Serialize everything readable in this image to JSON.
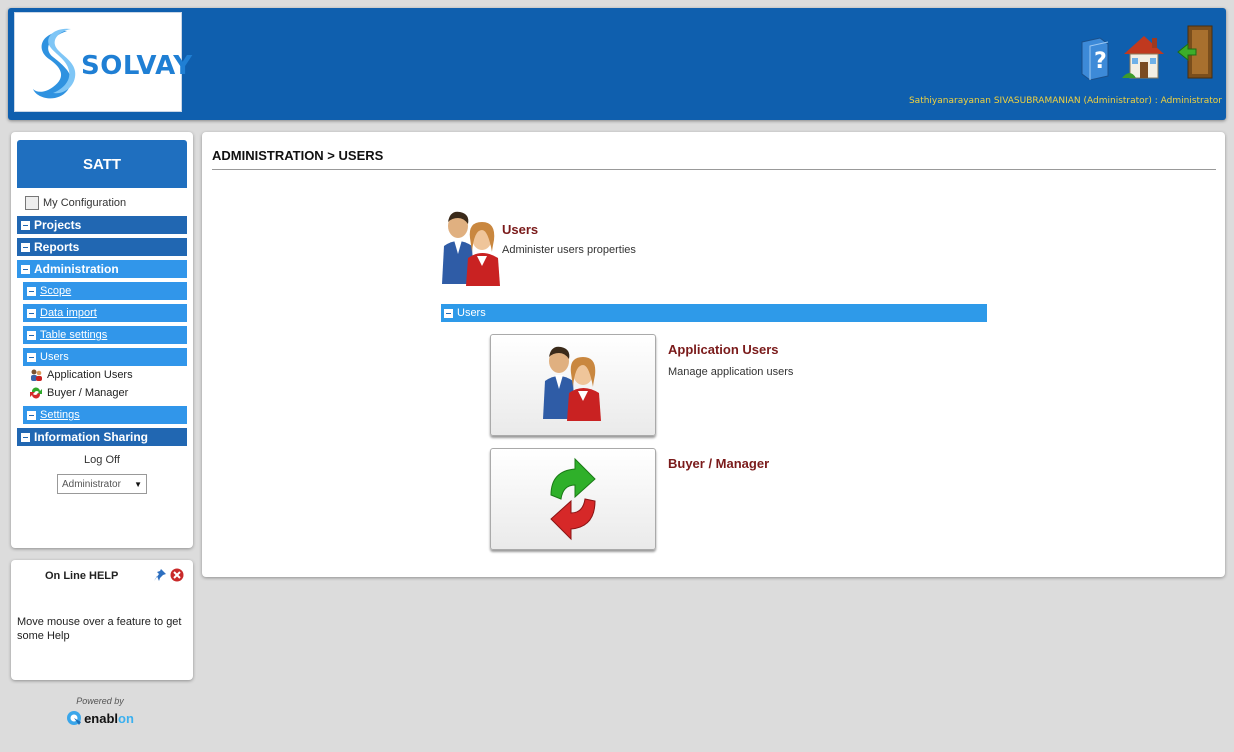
{
  "header": {
    "brand": "SOLVAY",
    "user_line": "Sathiyanarayanan SIVASUBRAMANIAN (Administrator) : Administrator",
    "icons": [
      "help-icon",
      "home-icon",
      "logout-door-icon"
    ]
  },
  "sidebar": {
    "title": "SATT",
    "my_configuration": "My Configuration",
    "menu": {
      "projects": "Projects",
      "reports": "Reports",
      "administration": "Administration",
      "scope": "Scope",
      "data_import": "Data import",
      "table_settings": "Table settings",
      "users": "Users",
      "application_users": "Application Users",
      "buyer_manager": "Buyer / Manager",
      "settings": "Settings",
      "information_sharing": "Information Sharing"
    },
    "log_off": "Log Off",
    "role_selected": "Administrator"
  },
  "help": {
    "title": "On Line HELP",
    "text": "Move mouse over a feature to get some Help"
  },
  "footer": {
    "powered_by": "Powered by",
    "brand_prefix": "enabl",
    "brand_suffix": "on"
  },
  "main": {
    "breadcrumb": "ADMINISTRATION > USERS",
    "section_title": "Users",
    "section_desc": "Administer users properties",
    "bar_label": "Users",
    "tiles": [
      {
        "title": "Application Users",
        "desc": "Manage application users"
      },
      {
        "title": "Buyer / Manager",
        "desc": ""
      }
    ]
  },
  "colors": {
    "header_blue": "#0f5fae",
    "menu_dark": "#2167b2",
    "menu_light": "#3196ea",
    "title_red": "#7a1a1a"
  }
}
